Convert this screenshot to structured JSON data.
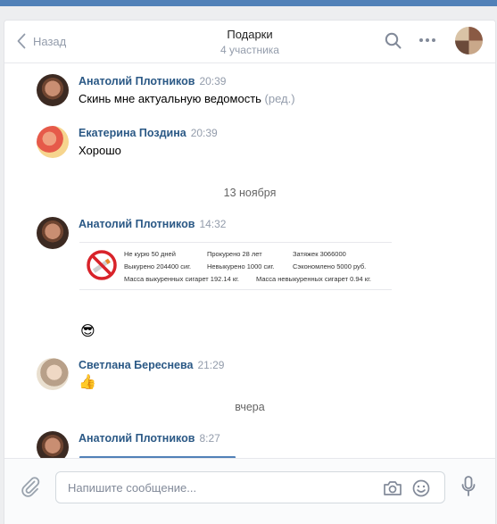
{
  "header": {
    "back_label": "Назад",
    "title": "Подарки",
    "subtitle": "4 участника"
  },
  "messages": [
    {
      "author": "Анатолий Плотников",
      "time": "20:39",
      "text": "Скинь мне актуальную ведомость",
      "edited": "(ред.)"
    },
    {
      "author": "Екатерина Поздина",
      "time": "20:39",
      "text": "Хорошо"
    },
    {
      "author": "Анатолий Плотников",
      "time": "14:32"
    },
    {
      "author": "Светлана Береснева",
      "time": "21:29",
      "emoji": "👍"
    },
    {
      "author": "Анатолий Плотников",
      "time": "8:27"
    }
  ],
  "date_separators": [
    "13 ноября",
    "вчера"
  ],
  "stat_card": {
    "items": [
      "Не курю 50 дней",
      "Прокурено 28 лет",
      "Затяжек 3066000",
      "Выкурено 204400 сиг.",
      "Невыкурено 1000 сиг.",
      "Сэкономлено 5000 руб.",
      "Масса выкуренных сигарет 192.14 кг.",
      "Масса невыкуренных сигарет 0.94 кг."
    ],
    "followup_emoji": "😎"
  },
  "composer": {
    "placeholder": "Напишите сообщение..."
  }
}
